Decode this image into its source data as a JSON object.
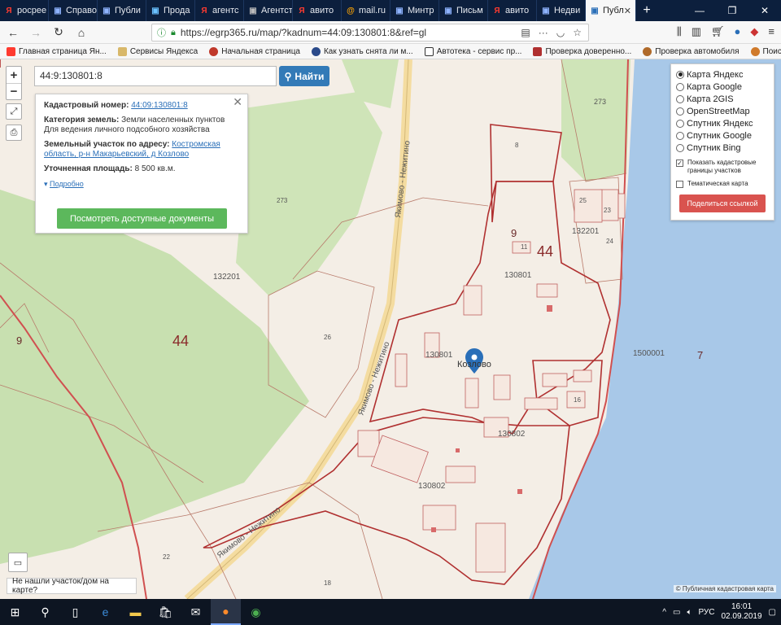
{
  "browser": {
    "tabs": [
      {
        "icon": "yandex-icon",
        "label": "росрее"
      },
      {
        "icon": "page-icon",
        "label": "Справо"
      },
      {
        "icon": "page-icon",
        "label": "Публи"
      },
      {
        "icon": "page-icon",
        "label": "Прода"
      },
      {
        "icon": "yandex-icon",
        "label": "агентс"
      },
      {
        "icon": "page-icon",
        "label": "Агентство"
      },
      {
        "icon": "yandex-icon",
        "label": "авито"
      },
      {
        "icon": "mail-icon",
        "label": "mail.ru"
      },
      {
        "icon": "page-icon",
        "label": "Минтр"
      },
      {
        "icon": "page-icon",
        "label": "Письм"
      },
      {
        "icon": "yandex-icon",
        "label": "авито"
      },
      {
        "icon": "page-icon",
        "label": "Недви"
      }
    ],
    "active_tab": {
      "label": "Публ"
    },
    "url": "https://egrp365.ru/map/?kadnum=44:09:130801:8&ref=gl",
    "bookmarks": [
      "Главная страница Ян...",
      "Сервисы Яндекса",
      "Начальная страница",
      "Как узнать снята ли м...",
      "Автотека - сервис пр...",
      "Проверка доверенно...",
      "Проверка автомобиля",
      "Поиск залога на маш..."
    ]
  },
  "map": {
    "search_value": "44:9:130801:8",
    "search_button": "Найти",
    "info_card": {
      "cadastral_label": "Кадастровый номер:",
      "cadastral_value": "44:09:130801:8",
      "category_label": "Категория земель:",
      "category_value": "Земли населенных пунктов Для ведения личного подсобного хозяйства",
      "address_label": "Земельный участок по адресу:",
      "address_value": "Костромская область, р-н Макарьевский, д Козлово",
      "area_label": "Уточненная площадь:",
      "area_value": "8 500 кв.м.",
      "more_label": "Подробно",
      "docs_button": "Посмотреть доступные документы"
    },
    "layers": [
      {
        "label": "Карта Яндекс",
        "selected": true
      },
      {
        "label": "Карта Google",
        "selected": false
      },
      {
        "label": "Карта 2GIS",
        "selected": false
      },
      {
        "label": "OpenStreetMap",
        "selected": false
      },
      {
        "label": "Спутник Яндекс",
        "selected": false
      },
      {
        "label": "Спутник Google",
        "selected": false
      },
      {
        "label": "Спутник Bing",
        "selected": false
      }
    ],
    "show_borders_label": "Показать кадастровые границы участков",
    "show_borders_checked": true,
    "thematic_label": "Тематическая карта",
    "thematic_checked": false,
    "share_button": "Поделиться ссылкой",
    "not_found_label": "Не нашли участок/дом на карте?",
    "copyright": "© Публичная кадастровая карта",
    "village": "Козлово",
    "road_label": "Якимово - Нежитино",
    "map_labels": [
      "273",
      "9",
      "44",
      "8",
      "25",
      "23",
      "132201",
      "24",
      "130801",
      "11",
      "44",
      "9",
      "26",
      "130801",
      "7",
      "1500001",
      "130802",
      "130802",
      "16",
      "18",
      "22",
      "273",
      "132201"
    ]
  },
  "taskbar": {
    "language": "РУС",
    "time": "16:01",
    "date": "02.09.2019"
  },
  "colors": {
    "tabbar": "#0c1f3d",
    "parcel_border": "#b03030",
    "water": "#a8c8e8",
    "forest": "#c8e0b0",
    "search_button": "#337ab7",
    "docs_button": "#5cb85c",
    "share_button": "#d9534f"
  }
}
